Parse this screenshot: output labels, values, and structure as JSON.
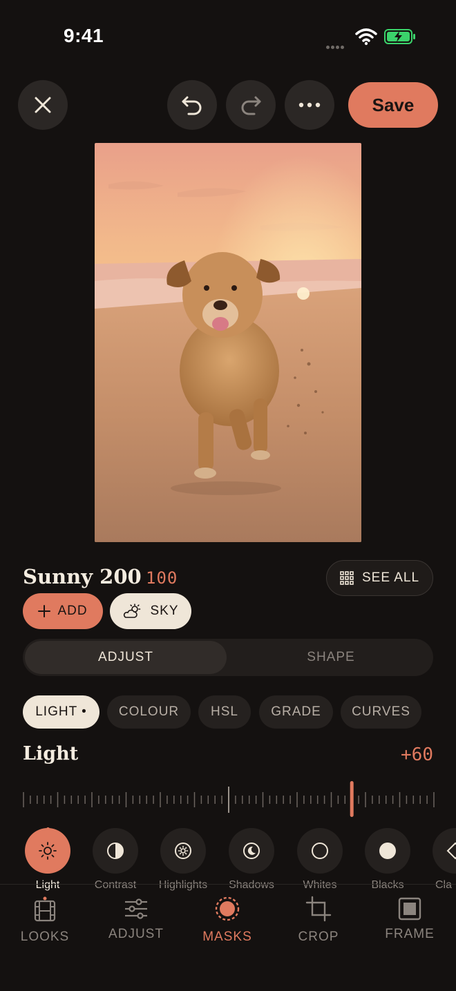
{
  "status_bar": {
    "time": "9:41"
  },
  "toolbar": {
    "save_label": "Save"
  },
  "preset": {
    "name": "Sunny 200",
    "value": "100",
    "see_all_label": "SEE ALL"
  },
  "mask_actions": {
    "add_label": "ADD",
    "sky_label": "SKY"
  },
  "segment": {
    "adjust": "ADJUST",
    "shape": "SHAPE"
  },
  "chips": [
    "LIGHT •",
    "COLOUR",
    "HSL",
    "GRADE",
    "CURVES"
  ],
  "slider": {
    "label": "Light",
    "value": "+60",
    "level": 60,
    "range": [
      -100,
      100
    ]
  },
  "tools": [
    "Light",
    "Contrast",
    "Highlights",
    "Shadows",
    "Whites",
    "Blacks",
    "Cla"
  ],
  "nav": [
    "LOOKS",
    "ADJUST",
    "MASKS",
    "CROP",
    "FRAME"
  ],
  "colors": {
    "accent": "#e07a5f",
    "background": "#141110",
    "chip": "#25211f",
    "cream": "#efe6d8"
  }
}
